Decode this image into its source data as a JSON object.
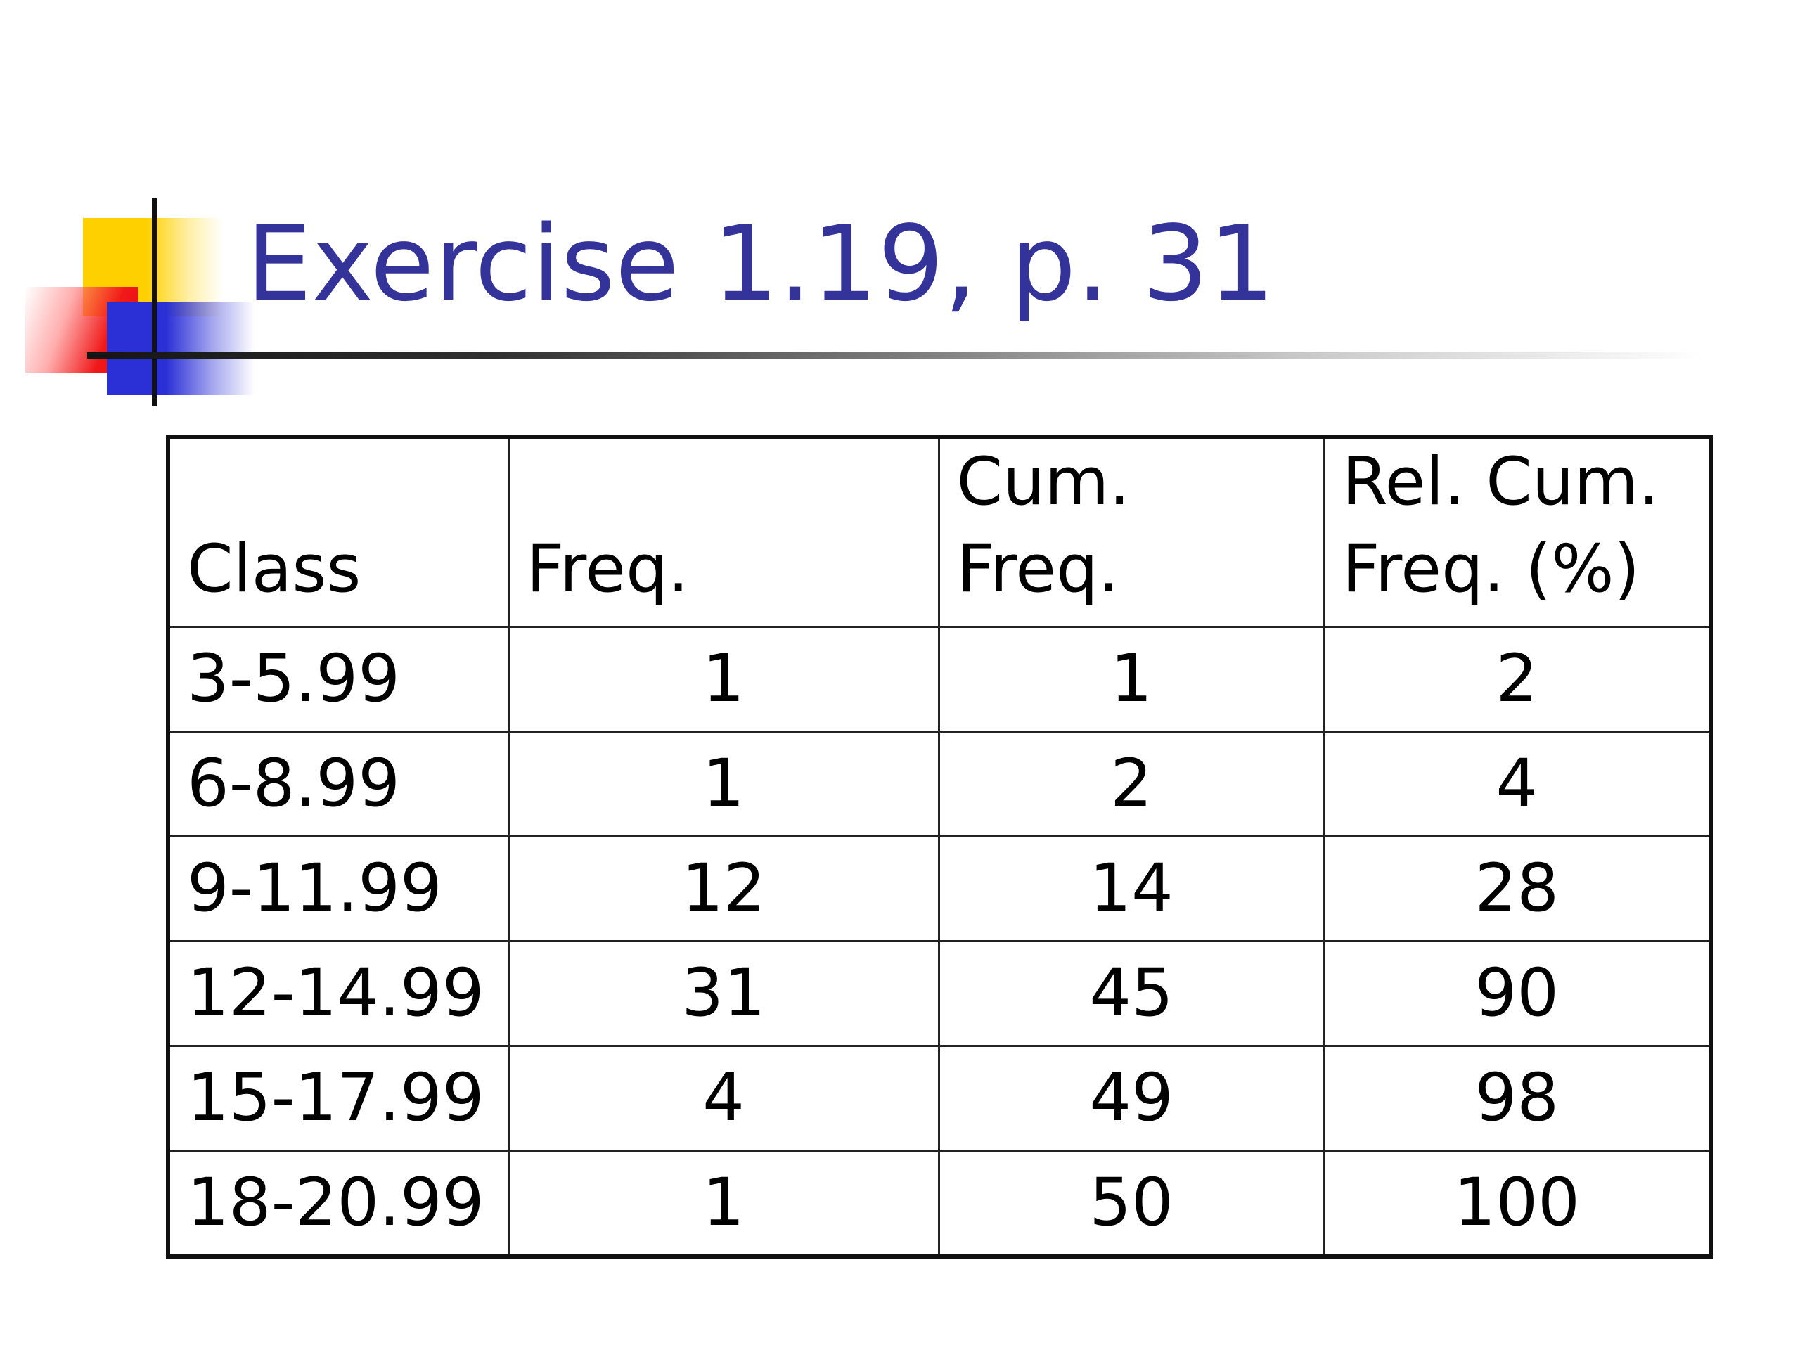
{
  "slide": {
    "title": "Exercise 1.19, p. 31"
  },
  "colors": {
    "title": "#333399",
    "logo_yellow": "#ffd000",
    "logo_red": "#e60f0f",
    "logo_blue": "#2a2fd6",
    "text": "#000000"
  },
  "table": {
    "headers": {
      "class": "Class",
      "freq": "Freq.",
      "cum_freq": "Cum. Freq.",
      "rel_cum_freq_line1": "Rel. Cum.",
      "rel_cum_freq_line2": "Freq. (%)"
    },
    "rows": [
      {
        "class": "3-5.99",
        "freq": "1",
        "cum_freq": "1",
        "rel_cum_freq": "2"
      },
      {
        "class": "6-8.99",
        "freq": "1",
        "cum_freq": "2",
        "rel_cum_freq": "4"
      },
      {
        "class": "9-11.99",
        "freq": "12",
        "cum_freq": "14",
        "rel_cum_freq": "28"
      },
      {
        "class": "12-14.99",
        "freq": "31",
        "cum_freq": "45",
        "rel_cum_freq": "90"
      },
      {
        "class": "15-17.99",
        "freq": "4",
        "cum_freq": "49",
        "rel_cum_freq": "98"
      },
      {
        "class": "18-20.99",
        "freq": "1",
        "cum_freq": "50",
        "rel_cum_freq": "100"
      }
    ]
  }
}
